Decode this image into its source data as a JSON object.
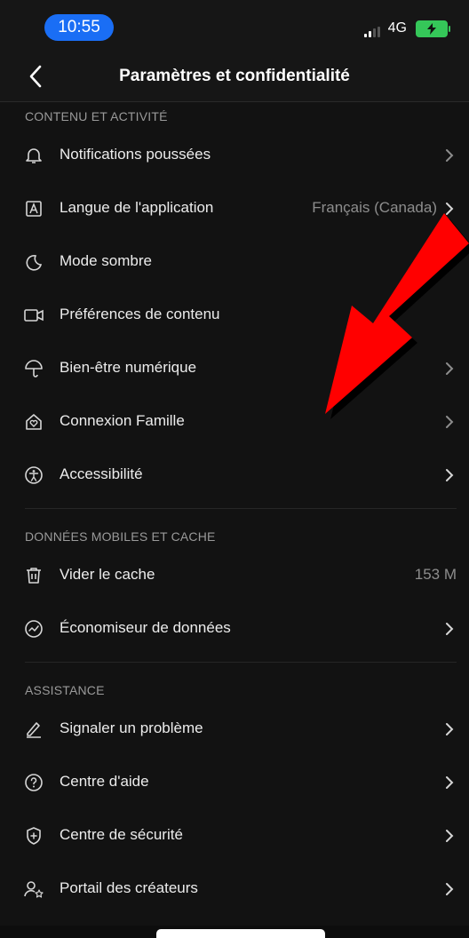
{
  "status_bar": {
    "time": "10:55",
    "network": "4G",
    "accent_color": "#1a6ef5",
    "battery_color": "#35c759"
  },
  "header": {
    "title": "Paramètres et confidentialité",
    "back_icon": "chevron-left-icon"
  },
  "sections": [
    {
      "title": "CONTENU ET ACTIVITÉ",
      "items": [
        {
          "icon": "bell-icon",
          "label": "Notifications poussées",
          "value": ""
        },
        {
          "icon": "language-icon",
          "label": "Langue de l'application",
          "value": "Français (Canada)"
        },
        {
          "icon": "moon-icon",
          "label": "Mode sombre",
          "value": ""
        },
        {
          "icon": "video-camera-icon",
          "label": "Préférences de contenu",
          "value": ""
        },
        {
          "icon": "umbrella-icon",
          "label": "Bien-être numérique",
          "value": ""
        },
        {
          "icon": "family-home-icon",
          "label": "Connexion Famille",
          "value": ""
        },
        {
          "icon": "accessibility-icon",
          "label": "Accessibilité",
          "value": ""
        }
      ]
    },
    {
      "title": "DONNÉES MOBILES ET CACHE",
      "items": [
        {
          "icon": "trash-icon",
          "label": "Vider le cache",
          "value": "153 M"
        },
        {
          "icon": "data-saver-icon",
          "label": "Économiseur de données",
          "value": ""
        }
      ]
    },
    {
      "title": "ASSISTANCE",
      "items": [
        {
          "icon": "pencil-icon",
          "label": "Signaler un problème",
          "value": ""
        },
        {
          "icon": "help-icon",
          "label": "Centre d'aide",
          "value": ""
        },
        {
          "icon": "shield-plus-icon",
          "label": "Centre de sécurité",
          "value": ""
        },
        {
          "icon": "creator-portal-icon",
          "label": "Portail des créateurs",
          "value": ""
        }
      ]
    }
  ],
  "annotation": {
    "icon": "red-arrow-icon",
    "color": "#ff0000"
  }
}
